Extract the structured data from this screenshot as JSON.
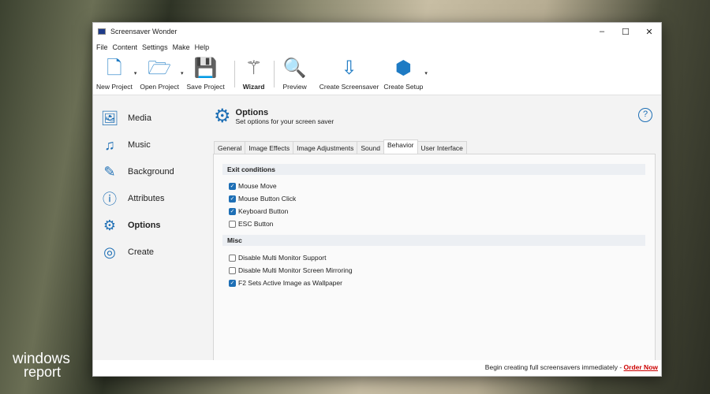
{
  "window": {
    "title": "Screensaver Wonder",
    "minimize": "–",
    "maximize": "☐",
    "close": "✕"
  },
  "menu": [
    "File",
    "Content",
    "Settings",
    "Make",
    "Help"
  ],
  "toolbar": [
    {
      "label": "New Project",
      "icon": "🗋"
    },
    {
      "label": "Open Project",
      "icon": "🗁"
    },
    {
      "label": "Save Project",
      "icon": "💾"
    },
    {
      "label": "Wizard",
      "icon": "⚚"
    },
    {
      "label": "Preview",
      "icon": "🔍"
    },
    {
      "label": "Create Screensaver",
      "icon": "⇩"
    },
    {
      "label": "Create Setup",
      "icon": "⬢"
    }
  ],
  "dropdown_arrow": "▾",
  "sidebar": [
    {
      "label": "Media",
      "icon": "🖼"
    },
    {
      "label": "Music",
      "icon": "♫"
    },
    {
      "label": "Background",
      "icon": "✎"
    },
    {
      "label": "Attributes",
      "icon": "ⓘ"
    },
    {
      "label": "Options",
      "icon": "⚙"
    },
    {
      "label": "Create",
      "icon": "◎"
    }
  ],
  "header": {
    "title": "Options",
    "subtitle": "Set options for your screen saver",
    "icon": "⚙",
    "help": "?"
  },
  "tabs": [
    "General",
    "Image Effects",
    "Image Adjustments",
    "Sound",
    "Behavior",
    "User Interface"
  ],
  "sections": [
    {
      "title": "Exit conditions",
      "items": [
        {
          "label": "Mouse Move",
          "checked": true
        },
        {
          "label": "Mouse Button Click",
          "checked": true
        },
        {
          "label": "Keyboard Button",
          "checked": true
        },
        {
          "label": "ESC Button",
          "checked": false
        }
      ]
    },
    {
      "title": "Misc",
      "items": [
        {
          "label": "Disable Multi Monitor Support",
          "checked": false
        },
        {
          "label": "Disable Multi Monitor Screen Mirroring",
          "checked": false
        },
        {
          "label": "F2 Sets Active Image as Wallpaper",
          "checked": true
        }
      ]
    }
  ],
  "status": {
    "text": "Begin creating full screensavers immediately - ",
    "link": "Order Now"
  },
  "watermark": {
    "line1": "windows",
    "line2": "report"
  },
  "check": "✓"
}
